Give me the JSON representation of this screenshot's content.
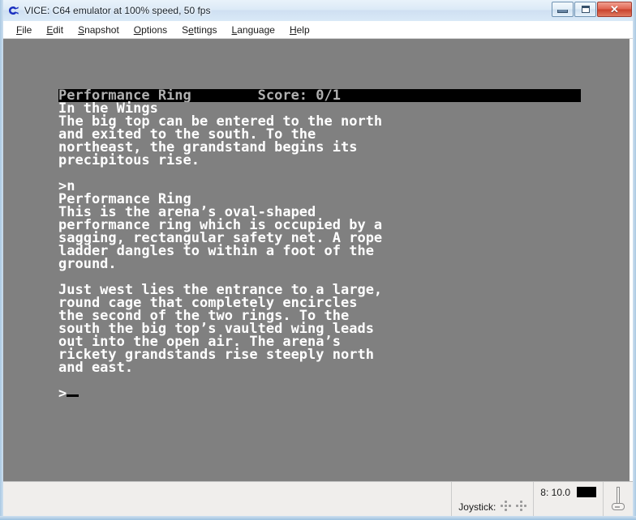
{
  "window": {
    "title": "VICE: C64 emulator at 100% speed, 50 fps",
    "icon": "commodore-logo-icon",
    "caption": {
      "minimize": "–",
      "maximize": "□",
      "close": "✕"
    }
  },
  "menubar": {
    "items": [
      {
        "label": "File",
        "accel": "F"
      },
      {
        "label": "Edit",
        "accel": "E"
      },
      {
        "label": "Snapshot",
        "accel": "S"
      },
      {
        "label": "Options",
        "accel": "O"
      },
      {
        "label": "Settings",
        "accel": "e"
      },
      {
        "label": "Language",
        "accel": "L"
      },
      {
        "label": "Help",
        "accel": "H"
      }
    ]
  },
  "screen": {
    "background_color": "#808080",
    "text_color": "#ffffff",
    "status_bar_bg": "#000000",
    "status_bar_fg": "#b0b0b0",
    "status_line": "Performance Ring        Score: 0/1",
    "lines": [
      "In the Wings",
      "The big top can be entered to the north",
      "and exited to the south. To the",
      "northeast, the grandstand begins its",
      "precipitous rise.",
      "",
      ">n",
      "Performance Ring",
      "This is the arena’s oval-shaped",
      "performance ring which is occupied by a",
      "sagging, rectangular safety net. A rope",
      "ladder dangles to within a foot of the",
      "ground.",
      "",
      "Just west lies the entrance to a large,",
      "round cage that completely encircles",
      "the second of the two rings. To the",
      "south the big top’s vaulted wing leads",
      "out into the open air. The arena’s",
      "rickety grandstands rise steeply north",
      "and east.",
      "",
      ">"
    ],
    "prompt": ">"
  },
  "statusbar": {
    "joystick_label": "Joystick:",
    "drive_label": "8: 10.0",
    "drive_led_color": "#000000",
    "tape_icon": "tape-icon"
  }
}
